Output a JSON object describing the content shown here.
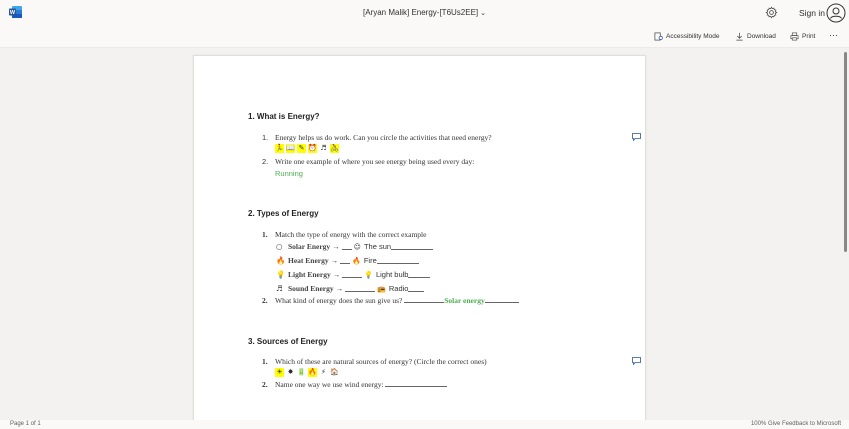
{
  "app": {
    "icon": "word-icon"
  },
  "header": {
    "title": "[Aryan Malik] Energy-[T6Us2EE]",
    "sign_in": "Sign in"
  },
  "toolbar": {
    "accessibility": "Accessibility Mode",
    "download": "Download",
    "print": "Print",
    "more": "···"
  },
  "document": {
    "s1": {
      "heading": "1. What is Energy?",
      "q1": {
        "num": "1.",
        "text": "Energy helps us do work. Can you circle the activities that need energy?"
      },
      "q1_emojis": [
        "🏃",
        "📖",
        "✎",
        "⏰",
        "♬",
        "🚴"
      ],
      "q2": {
        "num": "2.",
        "text": "Write one example of where you see energy being used every day:"
      },
      "q2_answer": "Running"
    },
    "s2": {
      "heading": "2. Types of Energy",
      "q1": {
        "num": "1.",
        "text": "Match the type of energy with the correct example"
      },
      "matches": [
        {
          "icon": "○",
          "name": "Solar Energy",
          "arrow": "→",
          "emoji": "☺",
          "example": "The sun"
        },
        {
          "icon": "🔥",
          "name": "Heat Energy",
          "arrow": "→",
          "emoji": "🔥",
          "example": "Fire"
        },
        {
          "icon": "💡",
          "name": "Light Energy",
          "arrow": "→",
          "emoji": "💡",
          "example": "Light bulb"
        },
        {
          "icon": "♬",
          "name": "Sound Energy",
          "arrow": "→",
          "emoji": "📻",
          "example": "Radio"
        }
      ],
      "q2": {
        "num": "2.",
        "text": "What kind of energy does the sun give us?"
      },
      "q2_answer": "Solar energy"
    },
    "s3": {
      "heading": "3. Sources of Energy",
      "q1": {
        "num": "1.",
        "text": "Which of these are natural sources of energy? (Circle the correct ones)"
      },
      "q1_emojis": [
        "☀",
        "✸",
        "🔋",
        "🔥",
        "⚡",
        "🏠"
      ],
      "q2": {
        "num": "2.",
        "text": "Name one way we use wind energy:"
      }
    }
  },
  "status": {
    "page": "Page 1 of 1",
    "right": "100%   Give Feedback to Microsoft"
  },
  "colors": {
    "answer": "#4caf50",
    "highlight": "#ffff00",
    "word_blue": "#2b579a"
  }
}
